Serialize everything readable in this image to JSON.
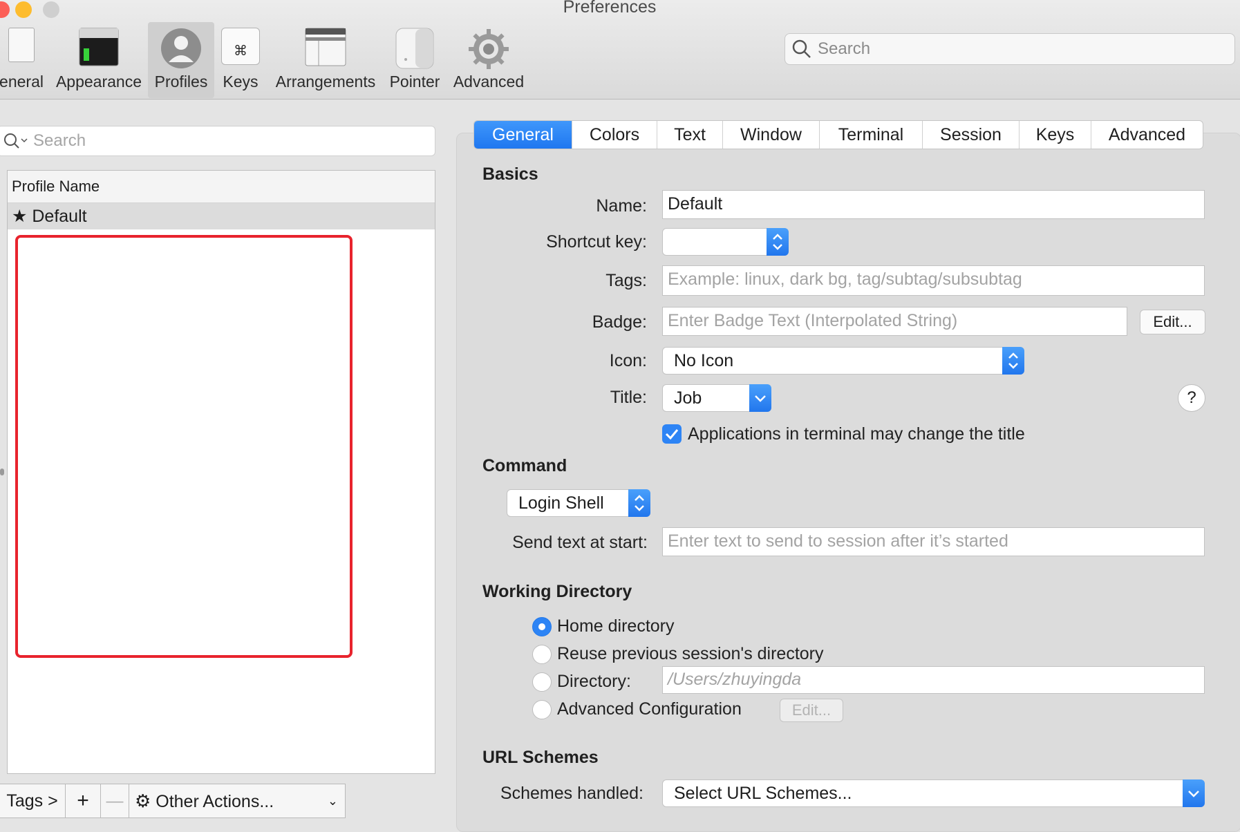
{
  "window": {
    "title": "Preferences"
  },
  "toolbar": {
    "items": [
      {
        "label": "eneral"
      },
      {
        "label": "Appearance"
      },
      {
        "label": "Profiles"
      },
      {
        "label": "Keys"
      },
      {
        "label": "Arrangements"
      },
      {
        "label": "Pointer"
      },
      {
        "label": "Advanced"
      }
    ],
    "search_placeholder": "Search"
  },
  "profiles": {
    "search_placeholder": "Search",
    "column_header": "Profile Name",
    "rows": [
      {
        "name": "Default",
        "icon": "star-icon"
      }
    ]
  },
  "bottom_bar": {
    "tags": "Tags >",
    "add": "+",
    "remove": "—",
    "other_actions": "Other Actions..."
  },
  "tabs": [
    "General",
    "Colors",
    "Text",
    "Window",
    "Terminal",
    "Session",
    "Keys",
    "Advanced"
  ],
  "general": {
    "basics_title": "Basics",
    "name_label": "Name:",
    "name_value": "Default",
    "shortcut_label": "Shortcut key:",
    "tags_label": "Tags:",
    "tags_placeholder": "Example: linux, dark bg, tag/subtag/subsubtag",
    "badge_label": "Badge:",
    "badge_placeholder": "Enter Badge Text (Interpolated String)",
    "badge_edit": "Edit...",
    "icon_label": "Icon:",
    "icon_value": "No Icon",
    "title_label": "Title:",
    "title_value": "Job",
    "help": "?",
    "apps_change_title": "Applications in terminal may change the title",
    "command_title": "Command",
    "command_value": "Login Shell",
    "send_text_label": "Send text at start:",
    "send_text_placeholder": "Enter text to send to session after it’s started",
    "wd_title": "Working Directory",
    "wd_home": "Home directory",
    "wd_reuse": "Reuse previous session's directory",
    "wd_directory": "Directory:",
    "wd_directory_placeholder": "/Users/zhuyingda",
    "wd_advanced": "Advanced Configuration",
    "wd_edit": "Edit...",
    "url_title": "URL Schemes",
    "schemes_label": "Schemes handled:",
    "schemes_value": "Select URL Schemes..."
  },
  "colors": {
    "accent": "#2d84f5",
    "highlight_box": "#e8232d"
  }
}
